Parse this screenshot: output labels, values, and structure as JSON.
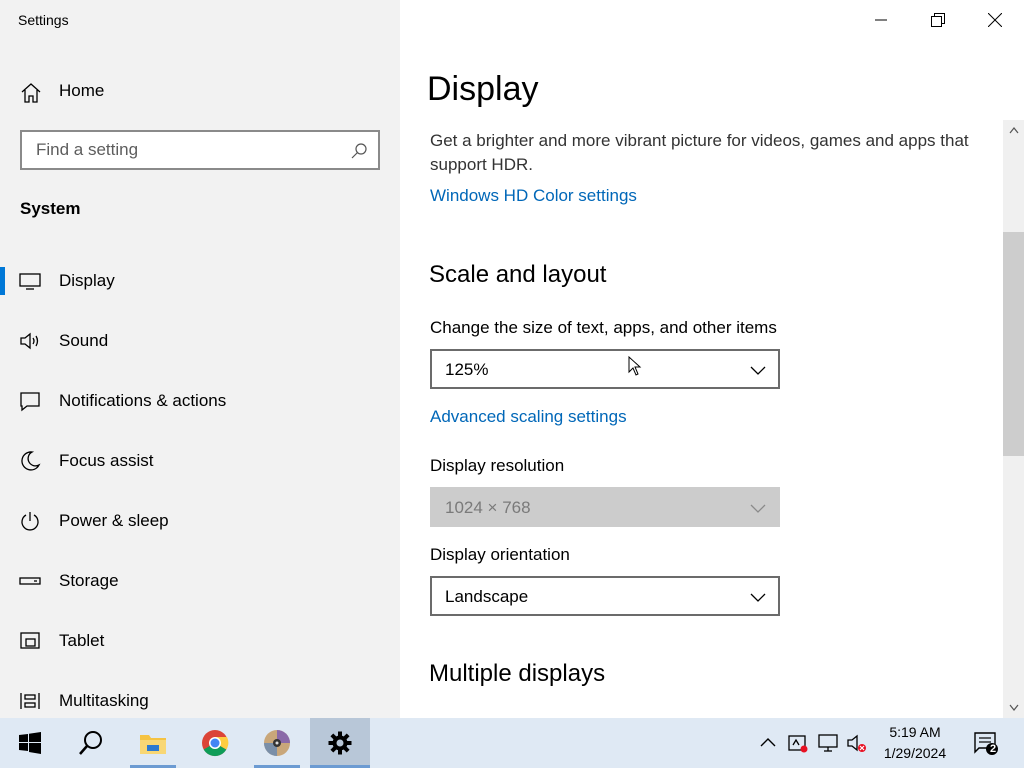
{
  "app": {
    "title": "Settings"
  },
  "sidebar": {
    "home_label": "Home",
    "search_placeholder": "Find a setting",
    "section_title": "System",
    "items": [
      {
        "label": "Display",
        "icon": "monitor-icon",
        "active": true
      },
      {
        "label": "Sound",
        "icon": "speaker-icon"
      },
      {
        "label": "Notifications & actions",
        "icon": "notification-icon"
      },
      {
        "label": "Focus assist",
        "icon": "moon-icon"
      },
      {
        "label": "Power & sleep",
        "icon": "power-icon"
      },
      {
        "label": "Storage",
        "icon": "storage-icon"
      },
      {
        "label": "Tablet",
        "icon": "tablet-icon"
      },
      {
        "label": "Multitasking",
        "icon": "multitasking-icon"
      }
    ]
  },
  "main": {
    "title": "Display",
    "hdr_description": "Get a brighter and more vibrant picture for videos, games and apps that support HDR.",
    "hdr_link": "Windows HD Color settings",
    "scale_heading": "Scale and layout",
    "scale_label": "Change the size of text, apps, and other items",
    "scale_value": "125%",
    "advanced_scaling_link": "Advanced scaling settings",
    "resolution_label": "Display resolution",
    "resolution_value": "1024 × 768",
    "orientation_label": "Display orientation",
    "orientation_value": "Landscape",
    "multiple_heading": "Multiple displays"
  },
  "taskbar": {
    "time": "5:19 AM",
    "date": "1/29/2024",
    "notification_count": "2",
    "apps": [
      "start-button",
      "search-button",
      "file-explorer",
      "chrome",
      "media-player",
      "settings"
    ]
  },
  "colors": {
    "accent": "#0078d7",
    "link": "#0067b8",
    "sidebar_bg": "#f2f2f2",
    "taskbar_bg": "#dfe9f4"
  }
}
